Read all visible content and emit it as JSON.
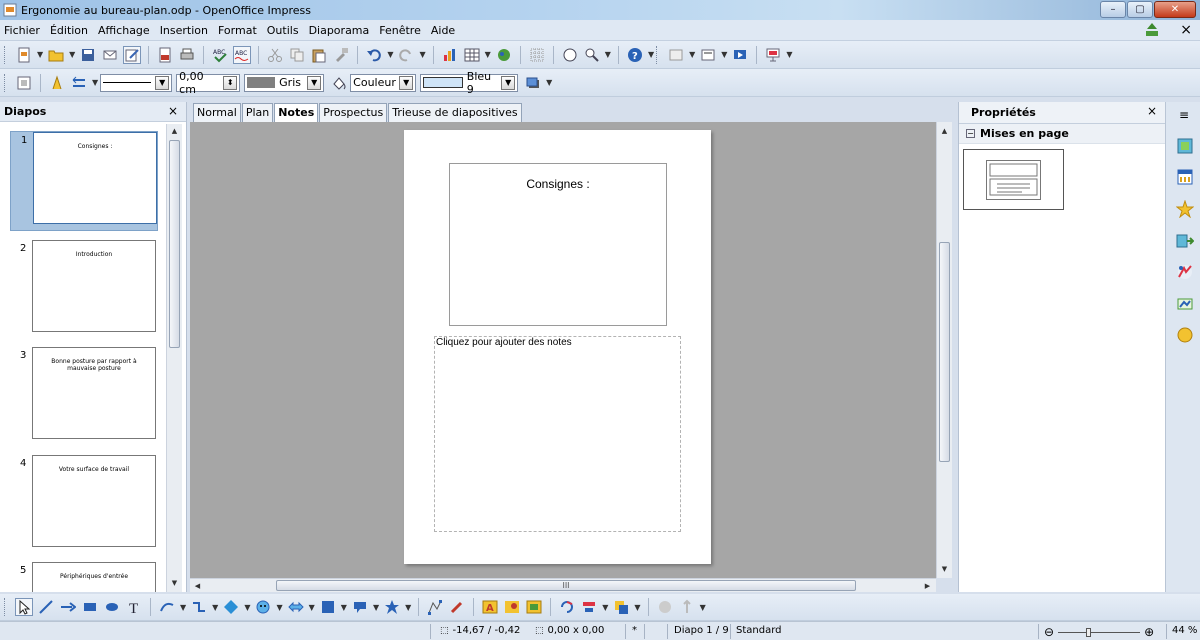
{
  "window": {
    "title": "Ergonomie au bureau-plan.odp - OpenOffice Impress",
    "minimize": "–",
    "maximize": "▢",
    "close": "✕"
  },
  "menu": [
    "Fichier",
    "Édition",
    "Affichage",
    "Insertion",
    "Format",
    "Outils",
    "Diaporama",
    "Fenêtre",
    "Aide"
  ],
  "menu_close": "×",
  "line_format": {
    "line_width": "0,00 cm",
    "line_color": "Gris",
    "area_style": "Couleur",
    "area_color": "Bleu 9",
    "line_color_hex": "#808080",
    "area_color_hex": "#cfe4f7"
  },
  "slides_panel": {
    "title": "Diapos",
    "close": "×",
    "slides": [
      {
        "number": "1",
        "title": "Consignes :",
        "selected": true
      },
      {
        "number": "2",
        "title": "Introduction",
        "selected": false
      },
      {
        "number": "3",
        "title": "Bonne posture par rapport à mauvaise posture",
        "selected": false
      },
      {
        "number": "4",
        "title": "Votre surface de travail",
        "selected": false
      },
      {
        "number": "5",
        "title": "Périphériques d'entrée",
        "selected": false
      }
    ]
  },
  "view_tabs": [
    "Normal",
    "Plan",
    "Notes",
    "Prospectus",
    "Trieuse de diapositives"
  ],
  "active_tab": "Notes",
  "notes_page": {
    "slide_title": "Consignes :",
    "notes_placeholder": "Cliquez pour ajouter des notes"
  },
  "hscroll_label": "III",
  "properties": {
    "title": "Propriétés",
    "close": "×",
    "menu_icon": "≡",
    "section": "Mises en page",
    "section_toggle": "−"
  },
  "status": {
    "position": "-14,67 / -0,42",
    "size": "0,00 x 0,00",
    "modified": "*",
    "slide": "Diapo 1 / 9",
    "master": "Standard",
    "zoom": "44 %",
    "zoom_minus": "⊖",
    "zoom_plus": "⊕"
  },
  "colors": {
    "accent": "#3d6fa8",
    "canvas": "#a6a6a6",
    "selected_slide": "#a8c4e0"
  }
}
